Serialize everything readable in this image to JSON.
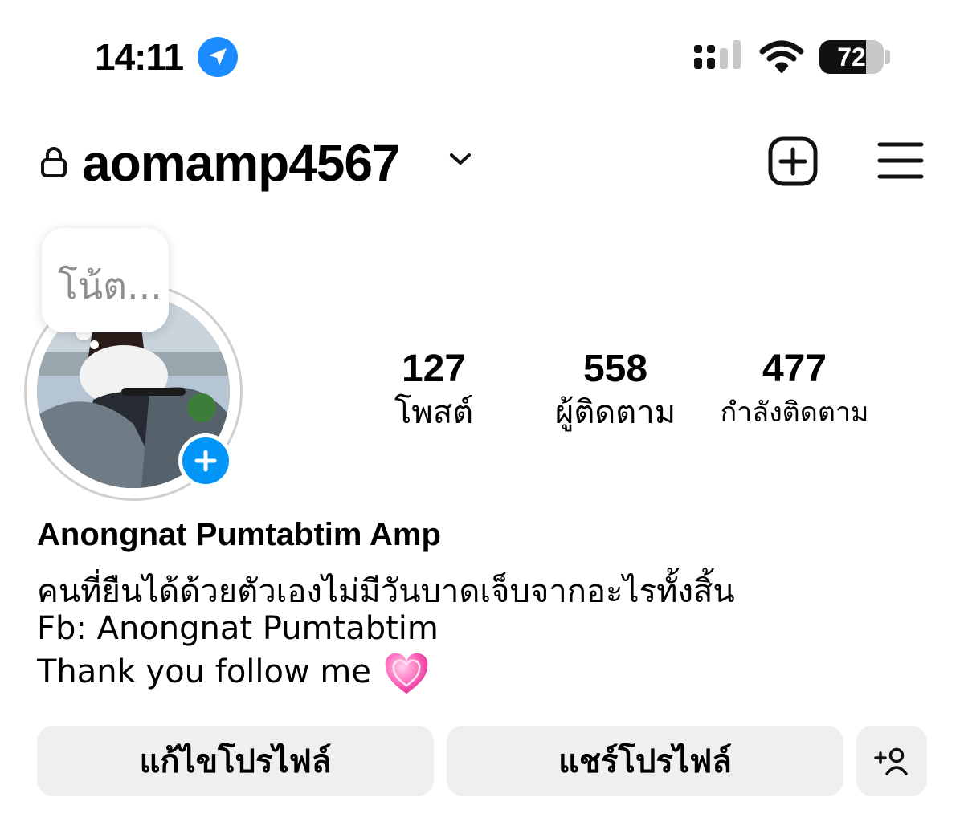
{
  "status_bar": {
    "time": "14:11",
    "battery_level": "72",
    "battery_fraction": 0.72,
    "icons": [
      "location-arrow-icon",
      "cellular-signal-icon",
      "wifi-icon",
      "battery-icon"
    ]
  },
  "header": {
    "username": "aomamp4567",
    "icons": [
      "lock-icon",
      "chevron-down-icon",
      "create-post-icon",
      "menu-icon"
    ]
  },
  "note": {
    "placeholder": "โน้ต..."
  },
  "stats": [
    {
      "value": "127",
      "label": "โพสต์"
    },
    {
      "value": "558",
      "label": "ผู้ติดตาม"
    },
    {
      "value": "477",
      "label": "กำลังติดตาม"
    }
  ],
  "bio": {
    "full_name": "Anongnat Pumtabtim Amp",
    "line1": "คนที่ยืนได้ด้วยตัวเองไม่มีวันบาดเจ็บจากอะไรทั้งสิ้น",
    "line2": "Fb: Anongnat Pumtabtim",
    "line3": "Thank you follow me"
  },
  "actions": {
    "edit_profile": "แก้ไขโปรไฟล์",
    "share_profile": "แชร์โปรไฟล์"
  },
  "colors": {
    "accent_blue": "#0095f6",
    "button_bg": "#efefef",
    "muted_text": "#8e8e8e"
  }
}
